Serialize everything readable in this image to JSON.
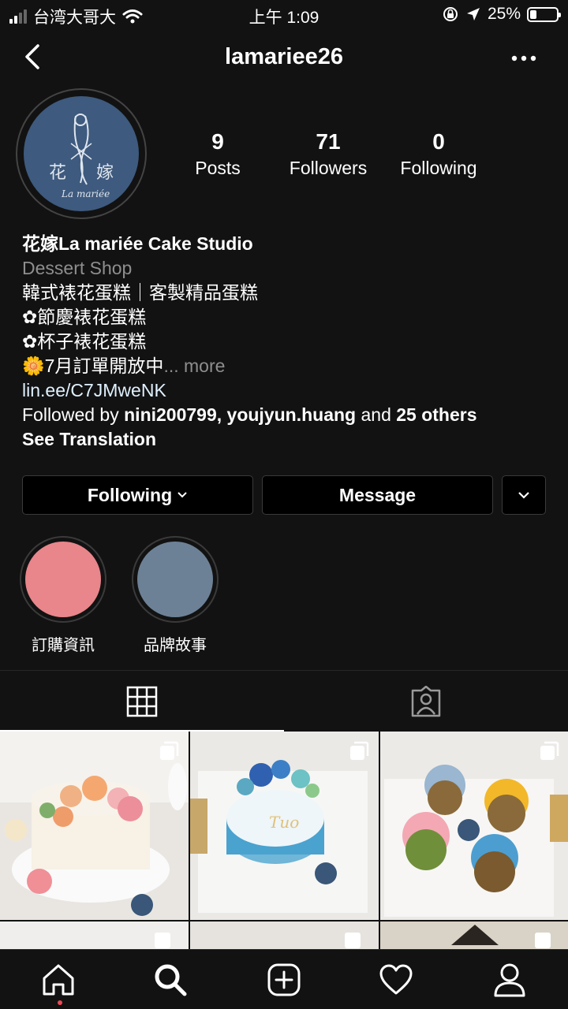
{
  "status_bar": {
    "carrier": "台湾大哥大",
    "time": "上午 1:09",
    "battery_percent": "25%",
    "battery_level": 0.25
  },
  "header": {
    "username": "lamariee26"
  },
  "profile": {
    "stats": [
      {
        "value": "9",
        "label": "Posts"
      },
      {
        "value": "71",
        "label": "Followers"
      },
      {
        "value": "0",
        "label": "Following"
      }
    ],
    "name": "花嫁La mariée Cake Studio",
    "category": "Dessert Shop",
    "bio_lines": [
      "韓式裱花蛋糕｜客製精品蛋糕",
      "✿節慶裱花蛋糕",
      "✿杯子裱花蛋糕",
      "🌼7月訂單開放中"
    ],
    "more_label": "... more",
    "link": "lin.ee/C7JMweNK",
    "followed_by": {
      "prefix": "Followed by ",
      "users": "nini200799, youjyun.huang",
      "middle": " and ",
      "others": "25 others"
    },
    "see_translation": "See Translation"
  },
  "buttons": {
    "following": "Following",
    "message": "Message"
  },
  "highlights": [
    {
      "label": "訂購資訊",
      "color": "#e8868b"
    },
    {
      "label": "品牌故事",
      "color": "#6d8196"
    }
  ],
  "colors": {
    "background": "#121212",
    "accent_dot": "#ed4956",
    "avatar": "#3e5a7e"
  }
}
